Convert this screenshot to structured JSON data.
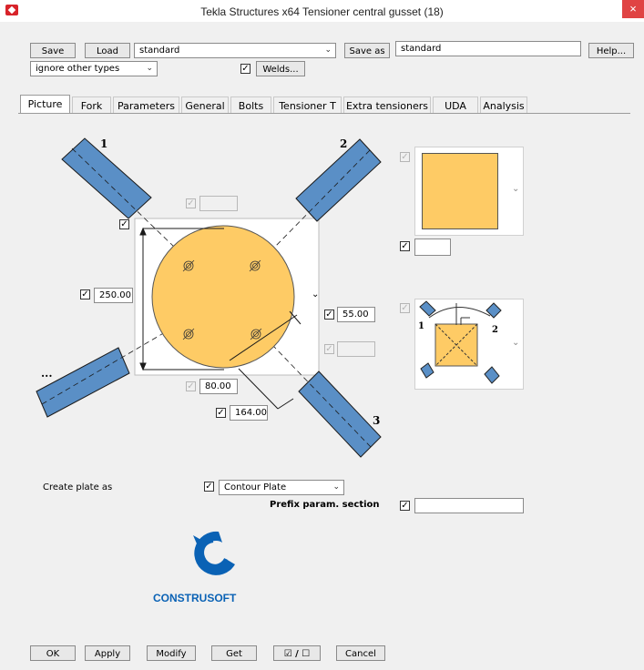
{
  "window": {
    "title": "Tekla Structures x64  Tensioner central gusset (18)",
    "close": "×"
  },
  "toolbar": {
    "save_label": "Save",
    "load_label": "Load",
    "preset_value": "standard",
    "save_as_label": "Save as",
    "save_as_value": "standard",
    "help_label": "Help...",
    "type_filter_value": "ignore other types",
    "welds_label": "Welds..."
  },
  "tabs": [
    "Picture",
    "Fork",
    "Parameters",
    "General",
    "Bolts",
    "Tensioner T",
    "Extra tensioners",
    "UDA",
    "Analysis"
  ],
  "picture": {
    "member_labels": {
      "m1": "1",
      "m2": "2",
      "m3": "3",
      "more": "..."
    },
    "fields": {
      "top_field": "",
      "height": "250.00",
      "offset_right": "55.00",
      "right_lower": "",
      "bottom_dim": "80.00",
      "diag_dim": "164.00",
      "shape_field": ""
    },
    "create_plate_label": "Create plate as",
    "create_plate_value": "Contour Plate",
    "prefix_label": "Prefix param. section",
    "prefix_value": ""
  },
  "logo": {
    "text": "CONSTRUSOFT"
  },
  "bottom": {
    "ok": "OK",
    "apply": "Apply",
    "modify": "Modify",
    "get": "Get",
    "toggle": "☑ / ☐",
    "cancel": "Cancel"
  },
  "colors": {
    "plate": "#fecb65",
    "member": "#5a8fc6",
    "accent": "#d8232a",
    "logo": "#0a62b5"
  }
}
